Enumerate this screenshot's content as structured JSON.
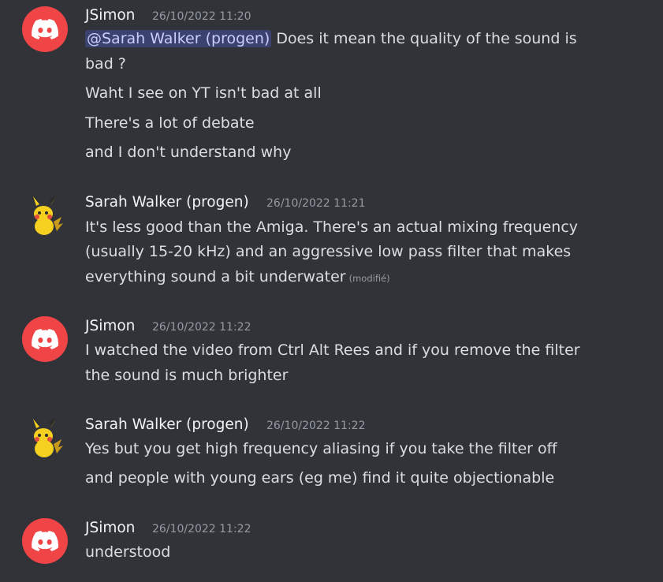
{
  "messages": [
    {
      "author": "JSimon",
      "timestamp": "26/10/2022 11:20",
      "avatar": "discord-logo-icon",
      "lines": [
        {
          "mention": "@Sarah Walker (progen)",
          "text": " Does it mean the quality of the sound is"
        },
        {
          "text": "bad ?"
        },
        {
          "text": "Waht I see on YT isn't bad at all"
        },
        {
          "text": "There's a lot of debate"
        },
        {
          "text": "and I don't understand why"
        }
      ]
    },
    {
      "author": "Sarah Walker (progen)",
      "timestamp": "26/10/2022 11:21",
      "avatar": "pikachu-icon",
      "lines": [
        {
          "text": "It's less good than the Amiga. There's an actual mixing frequency"
        },
        {
          "text": "(usually 15-20 kHz) and an aggressive low pass filter that makes"
        },
        {
          "text": "everything sound a bit underwater",
          "edited": "(modifié)"
        }
      ]
    },
    {
      "author": "JSimon",
      "timestamp": "26/10/2022 11:22",
      "avatar": "discord-logo-icon",
      "lines": [
        {
          "text": "I watched the video from Ctrl Alt Rees and if you remove the filter"
        },
        {
          "text": "the sound is much brighter"
        }
      ]
    },
    {
      "author": "Sarah Walker (progen)",
      "timestamp": "26/10/2022 11:22",
      "avatar": "pikachu-icon",
      "lines": [
        {
          "text": "Yes but you get high frequency aliasing if you take the filter off"
        },
        {
          "text": "and people with young ears (eg me) find it quite objectionable"
        }
      ]
    },
    {
      "author": "JSimon",
      "timestamp": "26/10/2022 11:22",
      "avatar": "discord-logo-icon",
      "lines": [
        {
          "text": "understood"
        }
      ]
    }
  ],
  "colors": {
    "background": "#313338",
    "discord_red": "#ef4547",
    "mention_bg": "#3c4270",
    "mention_text": "#c9cdfb"
  }
}
